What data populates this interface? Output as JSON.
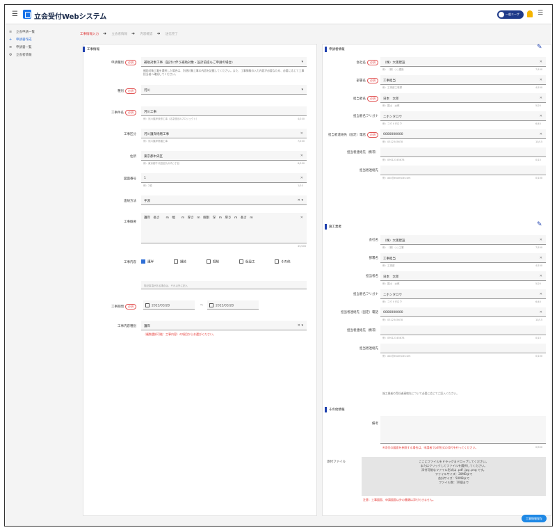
{
  "app": {
    "title": "立会受付Webシステム",
    "user_label": "一般ユーザ"
  },
  "sidebar": [
    {
      "icon": "≡",
      "label": "立会申請一覧"
    },
    {
      "icon": "+",
      "label": "申請書作成"
    },
    {
      "icon": "≡",
      "label": "申請書一覧"
    },
    {
      "icon": "⚙",
      "label": "立会者情報"
    }
  ],
  "breadcrumbs": [
    "工事情報入力",
    "立会者情報",
    "内容確認",
    "送信完了"
  ],
  "left": {
    "section": "工事情報",
    "fields": [
      {
        "label": "申請種別",
        "req": "必須",
        "value": "補助対象工事（設計に伴う補助対象・設計前提もご申請の場合）",
        "note": "補助対象工事を選択した場合は、別途対象工事の内容を記載してください。また、工事情報の入力内容が必要なため、必要に応じて工事担当者へ確認してください。"
      },
      {
        "label": "種別",
        "req": "必須",
        "value": "河川"
      },
      {
        "label": "工事件名",
        "req": "必須",
        "value": "河川工事",
        "hint": "例：河川護岸改修工事（応急復旧Aプロジェクト）",
        "count": "4/100"
      },
      {
        "label": "工事区分",
        "value": "河川護岸修繕工事",
        "hint": "例：河川護岸修繕工事",
        "count": "7/100"
      },
      {
        "label": "住所",
        "value": "東京都中央区",
        "hint": "例：東京都千代田区丸の内○丁目",
        "count": "6/100"
      },
      {
        "label": "図面番号",
        "value": "1",
        "hint": "例：2枚",
        "count": "1/10"
      },
      {
        "label": "連絡方法",
        "value": "手渡"
      },
      {
        "label": "工事概要",
        "value": "護岸　長さ　　m　幅　　m　厚さ　m　掘削　深　m　厚さ　m　長さ　m",
        "count": "45/200"
      },
      {
        "label": "工事内容",
        "options": [
          {
            "label": "護岸",
            "on": true
          },
          {
            "label": "舗装",
            "on": false
          },
          {
            "label": "掘削",
            "on": false
          },
          {
            "label": "仮設工",
            "on": false
          },
          {
            "label": "その他",
            "on": false
          }
        ],
        "hint2": "特記事項がある場合は、それ以外に記入"
      },
      {
        "label": "工事期間",
        "req": "必須",
        "from": "2023/03/28",
        "to": "2023/03/28",
        "sep": "〜"
      },
      {
        "label": "工事内容種別",
        "value": "護岸",
        "err": "（複数選択可能：工事内容）の項目からお選びください。"
      }
    ]
  },
  "right": {
    "sec1": "申請者情報",
    "s1": [
      {
        "label": "会社名",
        "req": "必須",
        "value": "（株）大阪建設",
        "hint": "例：（株）○○建設",
        "count": "7/100"
      },
      {
        "label": "部署名",
        "req": "必須",
        "value": "工事担当",
        "hint": "例：工事部工事課",
        "count": "4/100"
      },
      {
        "label": "担当者名",
        "req": "必須",
        "value": "日本　太郎",
        "hint": "例：国土　太郎",
        "count": "5/20"
      },
      {
        "label": "担当者名フリガナ",
        "value": "ニホンタロウ",
        "hint": "例：コクドタロウ",
        "count": "6/40"
      },
      {
        "label": "担当者連絡先（固定）電話",
        "req": "必須",
        "value": "0000000000",
        "hint": "例：0312345678",
        "count": "10/15"
      },
      {
        "label": "担当者連絡先（携帯）",
        "value": "",
        "hint": "例：09012345678",
        "count": "0/15"
      },
      {
        "label": "担当者連絡先",
        "value": "",
        "hint": "例：abc@example.com",
        "count": "0/100"
      }
    ],
    "sec2": "施工業者",
    "s2": [
      {
        "label": "会社名",
        "value": "（株）大阪建設",
        "hint": "例：（株）○○工業",
        "count": "7/100"
      },
      {
        "label": "部署名",
        "value": "工事担当",
        "hint": "例：工事部",
        "count": "4/100"
      },
      {
        "label": "担当者名",
        "value": "日本　太郎",
        "hint": "例：国土　太郎",
        "count": "5/20"
      },
      {
        "label": "担当者名フリガナ",
        "value": "ニホンタロウ",
        "hint": "例：コクドタロウ",
        "count": "6/40"
      },
      {
        "label": "担当者連絡先（固定）電話",
        "value": "0000000000",
        "hint": "例：0312345678",
        "count": "10/15"
      },
      {
        "label": "担当者連絡先（携帯）",
        "value": "",
        "hint": "例：09012345678",
        "count": "0/15"
      },
      {
        "label": "担当者連絡先",
        "value": "",
        "hint": "例：abc@example.com",
        "count": "0/100"
      }
    ],
    "s2note": "施工業者の責任者連絡先について必要に応じてご記入ください。",
    "sec3": "その他情報",
    "memo_label": "備考",
    "memo_err": "※添付の図面を参照する場合は、申請者でpdf形式の添付を行ってください。",
    "memo_count": "0/500",
    "attach_label": "添付ファイル",
    "upload": [
      "ここにファイルをドラッグ＆ドロップしてください。",
      "またはクリックしてファイルを選択してください。",
      "添付可能なファイル形式は .pdf .jpg .png です。",
      "ファイルサイズ：20MBまで",
      "合計サイズ：50MBまで",
      "ファイル数：10個まで"
    ],
    "attach_err": "注意：工事図面、申請図面以外の書類は添付できません。"
  },
  "save_button": "工事情報保存"
}
